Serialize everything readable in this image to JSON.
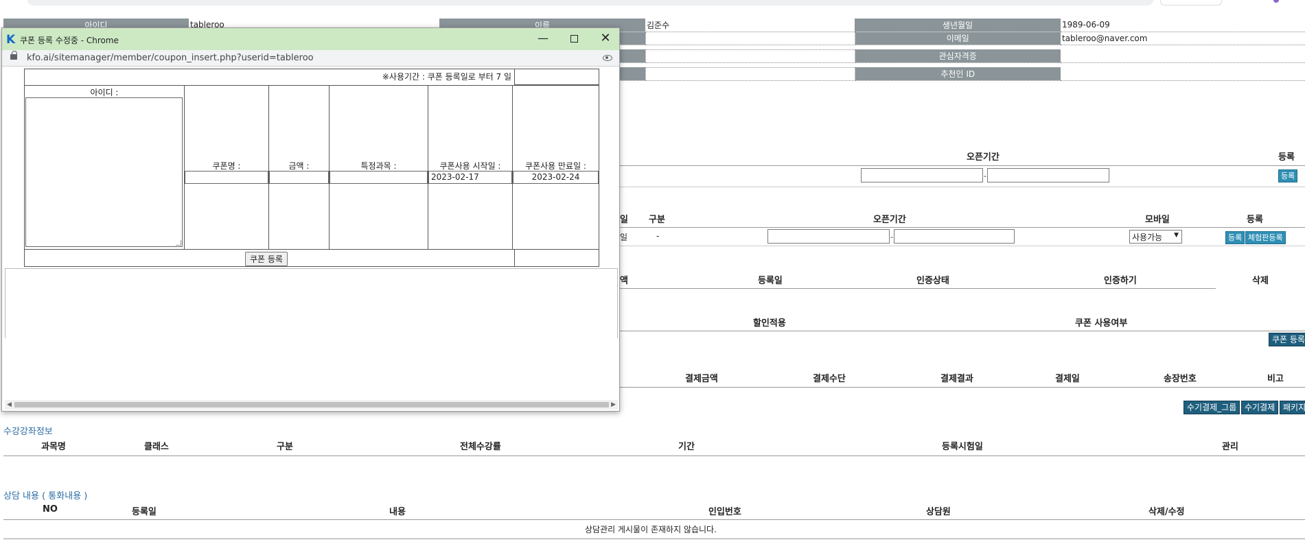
{
  "member_info": {
    "row1": {
      "id_label": "아이디",
      "id_value": "tableroo",
      "name_label": "이름",
      "name_value": "김준수",
      "birth_label": "생년월일",
      "birth_value": "1989-06-09"
    },
    "row2": {
      "email_label": "이메일",
      "email_value": "tableroo@naver.com"
    },
    "row3": {
      "interest_label": "관심자격증"
    },
    "row4": {
      "referrer_label": "추천인 ID"
    }
  },
  "section_open": {
    "open_period": "오픈기간",
    "register": "등록",
    "register_btn": "등록"
  },
  "section_mobile": {
    "col_date_frag": "일",
    "col_type": "구분",
    "col_open_period": "오픈기간",
    "col_mobile": "모바일",
    "col_register": "등록",
    "row_date_frag": "일",
    "row_type": "-",
    "mobile_select": "사용가능",
    "register_btn": "등록",
    "trial_btn": "체험판등록"
  },
  "section_cert": {
    "col_amount_frag": "액",
    "col_reg_date": "등록일",
    "col_status": "인증상태",
    "col_verify": "인증하기",
    "col_delete": "삭제"
  },
  "section_coupon": {
    "col_discount": "할인적용",
    "col_usage": "쿠폰 사용여부",
    "register_btn": "쿠폰 등록"
  },
  "section_payment": {
    "col_amount": "결제금액",
    "col_method": "결제수단",
    "col_result": "결제결과",
    "col_date": "결제일",
    "col_invoice": "송장번호",
    "col_note": "비고",
    "btn_manual_group": "수기결제_그룹",
    "btn_manual": "수기결제",
    "btn_package": "패키지"
  },
  "section_course": {
    "title": "수강강좌정보",
    "columns": [
      "과목명",
      "클래스",
      "구분",
      "전체수강률",
      "기간",
      "등록시험일",
      "관리"
    ]
  },
  "section_consult": {
    "title": "상담 내용 ( 통화내용 )",
    "columns": [
      "NO",
      "등록일",
      "내용",
      "인입번호",
      "상담원",
      "삭제/수정"
    ],
    "empty_message": "상담관리 게시물이 존재하지 않습니다."
  },
  "popup": {
    "logo": "K",
    "window_title": "쿠폰 등록 수정중 - Chrome",
    "url": "kfo.ai/sitemanager/member/coupon_insert.php?userid=tableroo",
    "notice": "※사용기간 : 쿠폰 등록일로 부터 7 일",
    "id_label": "아이디 :",
    "coupon_name_label": "쿠폰명 :",
    "amount_label": "금액 :",
    "course_label": "특정과목 :",
    "start_label": "쿠폰사용 시작일 :",
    "start_value": "2023-02-17",
    "end_label": "쿠폰사용 만료일 :",
    "end_value": "2023-02-24",
    "submit_label": "쿠폰 등록"
  },
  "icons": [
    "k-logo-icon",
    "minimize-icon",
    "maximize-icon",
    "close-icon",
    "lock-icon",
    "eye-icon",
    "scroll-left-icon",
    "scroll-right-icon"
  ]
}
